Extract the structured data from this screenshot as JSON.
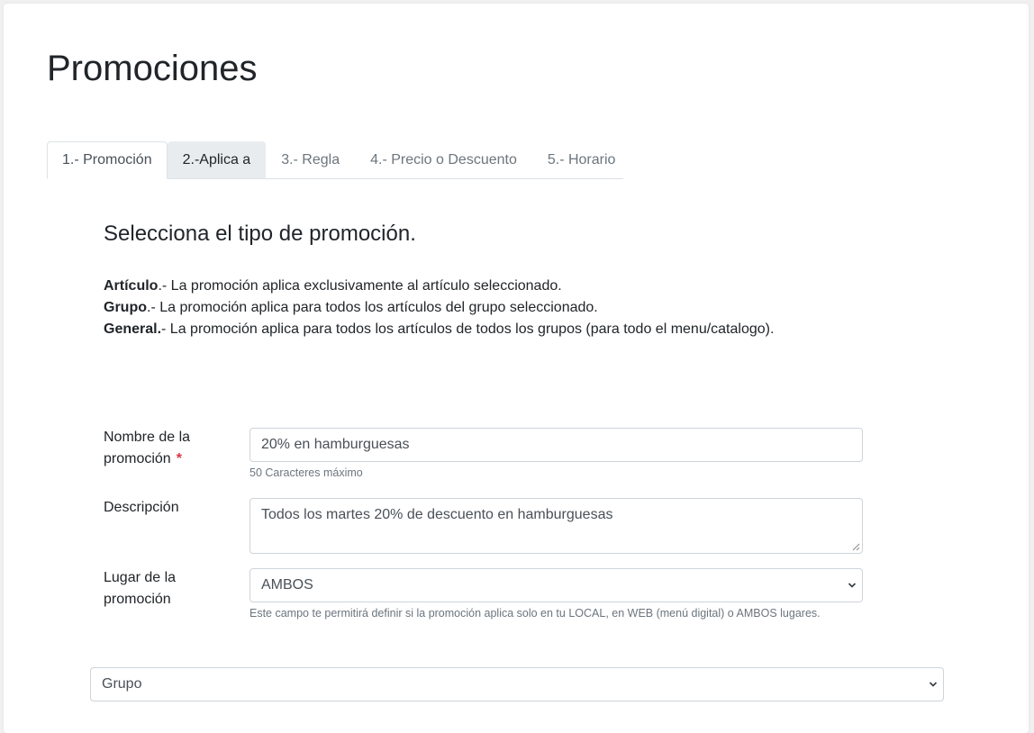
{
  "page": {
    "title": "Promociones"
  },
  "tabs": [
    {
      "label": "1.- Promoción",
      "state": "active"
    },
    {
      "label": "2.-Aplica a",
      "state": "hover"
    },
    {
      "label": "3.- Regla",
      "state": "default"
    },
    {
      "label": "4.- Precio o Descuento",
      "state": "default"
    },
    {
      "label": "5.- Horario",
      "state": "default"
    }
  ],
  "section": {
    "title": "Selecciona el tipo de promoción.",
    "descriptions": [
      {
        "term": "Artículo",
        "text": ".- La promoción aplica exclusivamente al artículo seleccionado."
      },
      {
        "term": "Grupo",
        "text": ".- La promoción aplica para todos los artículos del grupo seleccionado."
      },
      {
        "term": "General.",
        "text": "- La promoción aplica para todos los artículos de todos los grupos (para todo el menu/catalogo)."
      }
    ]
  },
  "form": {
    "name": {
      "label": "Nombre de la promoción",
      "required_mark": "*",
      "value": "20% en hamburguesas",
      "help": "50 Caracteres máximo"
    },
    "description": {
      "label": "Descripción",
      "value": "Todos los martes 20% de descuento en hamburguesas"
    },
    "place": {
      "label": "Lugar de la promoción",
      "value": "AMBOS",
      "help": "Este campo te permitirá definir si la promoción aplica solo en tu LOCAL, en WEB (menú digital) o AMBOS lugares."
    },
    "type": {
      "value": "Grupo"
    }
  },
  "colors": {
    "required": "#dc3545",
    "text": "#212529",
    "muted": "#6c757d",
    "border": "#ced4da",
    "tab_hover_bg": "#e9ecef"
  },
  "icons": {
    "select_arrow": "chevron-down-icon",
    "textarea_resize": "resize-grip-icon"
  }
}
